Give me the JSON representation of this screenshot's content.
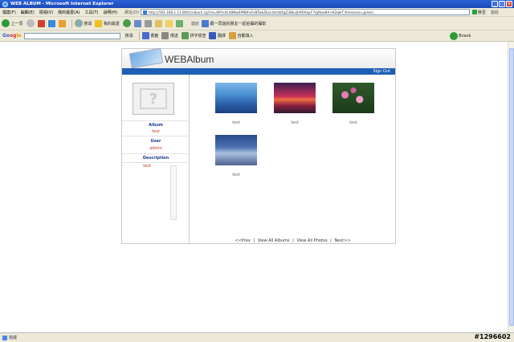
{
  "window": {
    "title": "WEB ALBUM - Microsoft Internet Explorer",
    "min_label": "_",
    "max_label": "□",
    "close_label": "×"
  },
  "menubar": {
    "items": [
      "檔案(F)",
      "編輯(E)",
      "檢視(V)",
      "我的最愛(A)",
      "工具(T)",
      "說明(H)"
    ],
    "address_label": "網址(D)",
    "address_value": "http://192.168.1.11:8001/album.cgi?id=KRYxdLhBNwSPNBhsFeBTwkZbsc4zmBXgZ3BkvJU9OAqLF7/gRow8X+K2qleT;timezone=green;",
    "go_label": "移至",
    "links_label": "連結"
  },
  "toolbar": {
    "back_label": "上一頁",
    "search_label": "搜尋",
    "favorites_label": "我的最愛",
    "links_bar_label": "連結",
    "link_text": "跟一同遊的朋友一起拍攝的攝影",
    "translate_label": "翻譯",
    "autofill_label": "自動填入",
    "check_label": "拼字檢查",
    "share_label": "傳送",
    "browse_label": "書籤",
    "extra_label": "Brwsk"
  },
  "googlebar": {
    "logo": [
      "Go",
      "og",
      "le"
    ],
    "search_label": "搜尋"
  },
  "album": {
    "brand_light": "WEB",
    "brand_bold": "Album",
    "signout": "Sign Out",
    "sidebar": {
      "album_label": "Album",
      "album_value": "test",
      "user_label": "User",
      "user_value": "admin",
      "description_label": "Description",
      "description_value": "test"
    },
    "photos": [
      {
        "caption": "test",
        "scene": "mountains"
      },
      {
        "caption": "test",
        "scene": "sunset"
      },
      {
        "caption": "test",
        "scene": "water-lilies"
      },
      {
        "caption": "test",
        "scene": "winter"
      }
    ],
    "pager": {
      "prev": "<<Prev",
      "view_albums": "View All Albums",
      "view_photos": "View All Photos",
      "next": "Next>>",
      "sep": "|"
    }
  },
  "statusbar": {
    "text": "完成"
  },
  "watermark": "#1296602",
  "colors": {
    "accent": "#1e5fb5",
    "label": "#1a3d8f",
    "value": "#c0392b"
  }
}
